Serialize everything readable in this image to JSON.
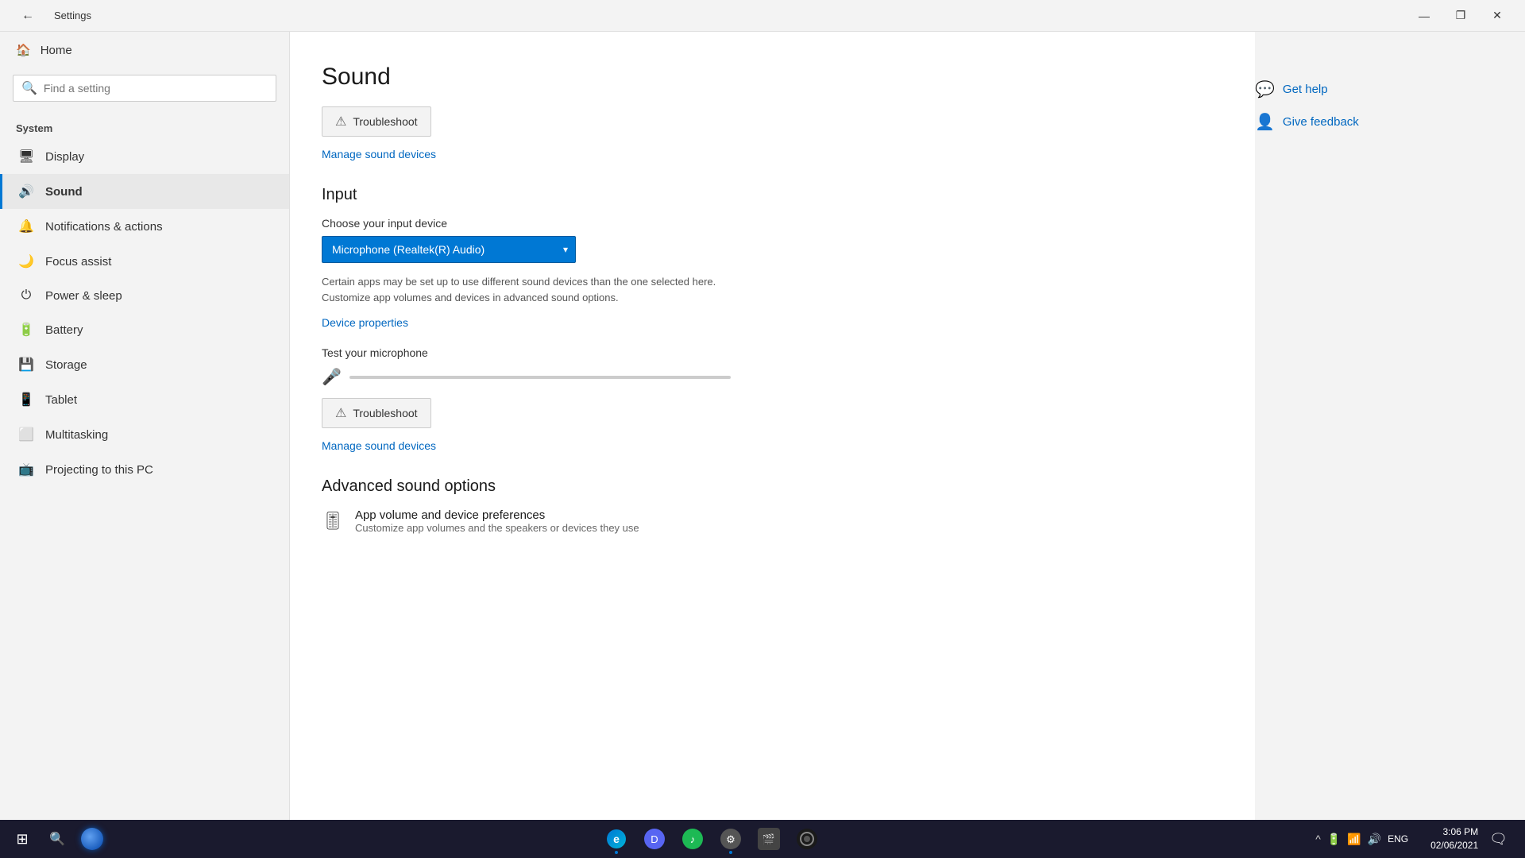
{
  "titlebar": {
    "title": "Settings",
    "back_icon": "←",
    "min_icon": "—",
    "max_icon": "❐",
    "close_icon": "✕"
  },
  "sidebar": {
    "home_label": "Home",
    "search_placeholder": "Find a setting",
    "category": "System",
    "items": [
      {
        "id": "display",
        "label": "Display",
        "icon": "🖥"
      },
      {
        "id": "sound",
        "label": "Sound",
        "icon": "🔊"
      },
      {
        "id": "notifications",
        "label": "Notifications & actions",
        "icon": "🔔"
      },
      {
        "id": "focus",
        "label": "Focus assist",
        "icon": "🌙"
      },
      {
        "id": "power",
        "label": "Power & sleep",
        "icon": "⏻"
      },
      {
        "id": "battery",
        "label": "Battery",
        "icon": "🔋"
      },
      {
        "id": "storage",
        "label": "Storage",
        "icon": "💾"
      },
      {
        "id": "tablet",
        "label": "Tablet",
        "icon": "📱"
      },
      {
        "id": "multitasking",
        "label": "Multitasking",
        "icon": "⬜"
      },
      {
        "id": "projecting",
        "label": "Projecting to this PC",
        "icon": "📺"
      }
    ]
  },
  "content": {
    "page_title": "Sound",
    "troubleshoot_output_label": "Troubleshoot",
    "manage_sound_link": "Manage sound devices",
    "input_section_title": "Input",
    "input_device_label": "Choose your input device",
    "input_device_selected": "Microphone (Realtek(R) Audio)",
    "input_desc": "Certain apps may be set up to use different sound devices than the one selected here. Customize app volumes and devices in advanced sound options.",
    "device_properties_link": "Device properties",
    "mic_test_label": "Test your microphone",
    "troubleshoot_input_label": "Troubleshoot",
    "manage_sound_link2": "Manage sound devices",
    "advanced_title": "Advanced sound options",
    "app_volume_title": "App volume and device preferences",
    "app_volume_desc": "Customize app volumes and the speakers or devices they use"
  },
  "right_panel": {
    "get_help_label": "Get help",
    "give_feedback_label": "Give feedback"
  },
  "taskbar": {
    "start_icon": "⊞",
    "search_icon": "🔍",
    "cortana_label": "Cortana",
    "apps": [
      {
        "id": "edge",
        "label": "Edge"
      },
      {
        "id": "discord",
        "label": "Discord"
      },
      {
        "id": "spotify",
        "label": "Spotify"
      },
      {
        "id": "settings",
        "label": "Settings"
      },
      {
        "id": "film",
        "label": "Films"
      }
    ],
    "tray": {
      "lang": "ENG",
      "time": "3:06 PM",
      "date": "02/06/2021"
    }
  }
}
